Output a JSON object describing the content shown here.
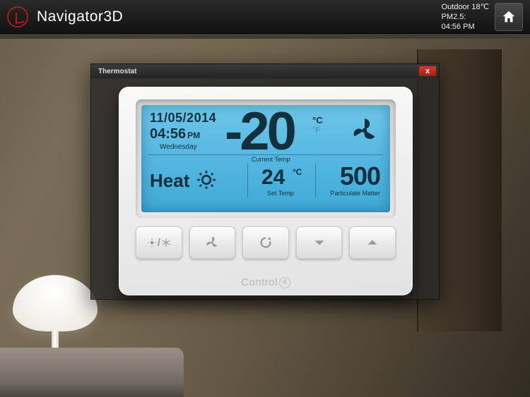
{
  "header": {
    "app_title": "Navigator3D",
    "status": {
      "outdoor_label": "Outdoor",
      "outdoor_value": "18℃",
      "pm25_label": "PM2.5:",
      "pm25_value": "",
      "clock": "04:56 PM"
    }
  },
  "dialog": {
    "title": "Thermostat",
    "close_glyph": "x"
  },
  "thermostat": {
    "date": "11/05/2014",
    "time": "04:56",
    "ampm": "PM",
    "day_of_week": "Wednesday",
    "current_temp": "-20",
    "current_temp_unit_primary": "°C",
    "current_temp_unit_secondary": "°F",
    "current_temp_label": "Current Temp",
    "mode": "Heat",
    "set_temp": "24",
    "set_temp_unit": "°C",
    "set_temp_label": "Set Temp",
    "pm_value": "500",
    "pm_label": "Particulate Matter",
    "brand": "Control",
    "brand_suffix": "4"
  }
}
